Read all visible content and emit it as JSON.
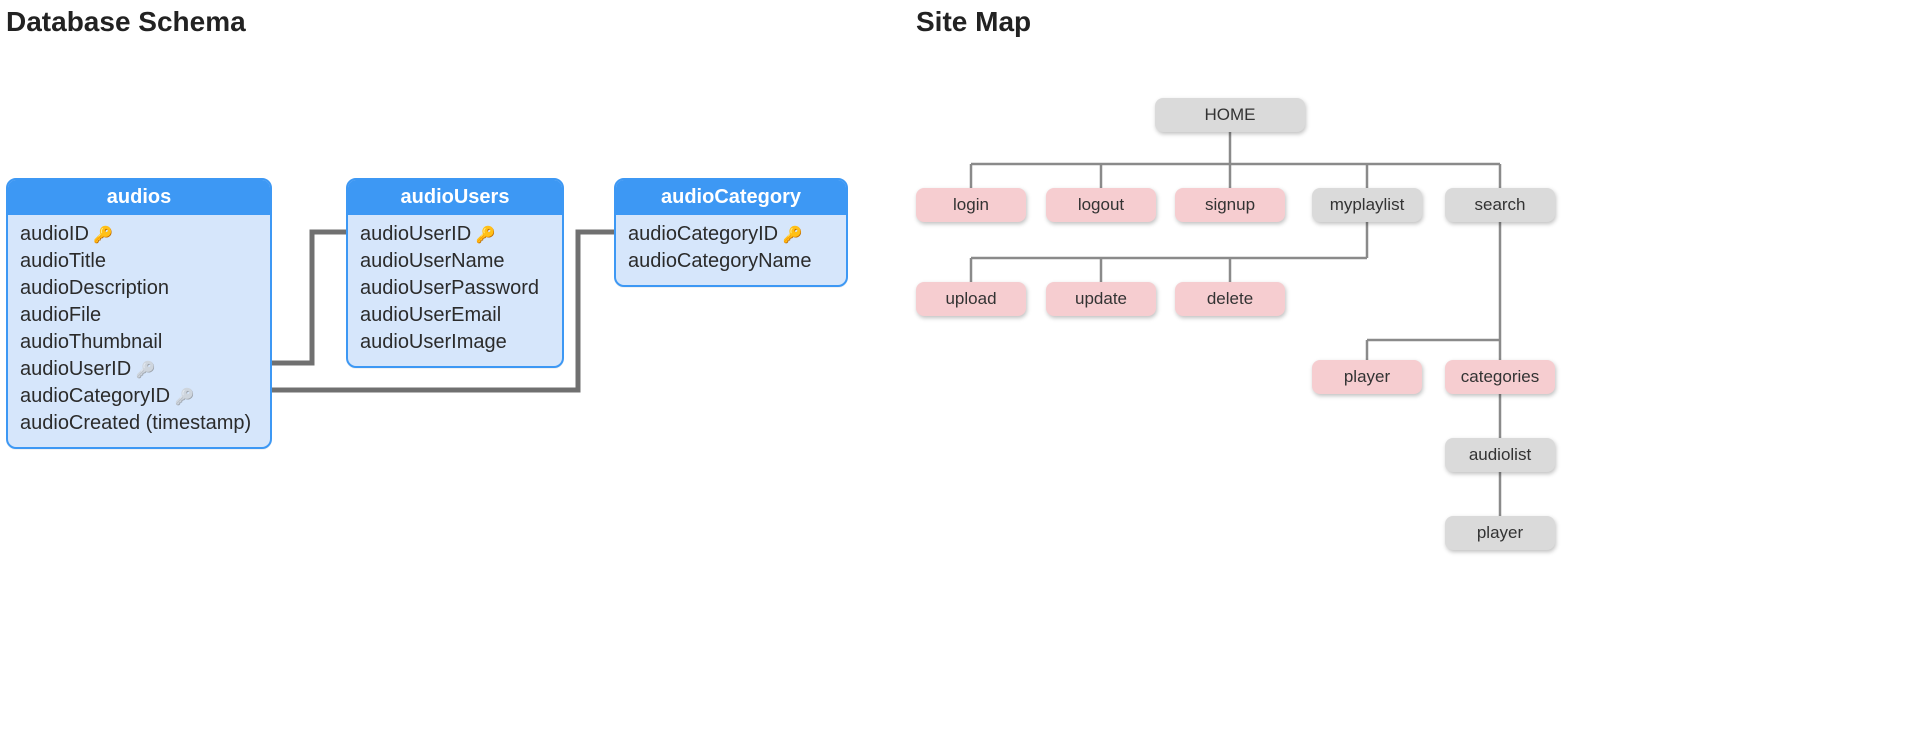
{
  "headings": {
    "schema": "Database Schema",
    "sitemap": "Site Map"
  },
  "schema": {
    "tables": [
      {
        "name": "audios",
        "fields": [
          {
            "name": "audioID",
            "key": "pk"
          },
          {
            "name": "audioTitle",
            "key": null
          },
          {
            "name": "audioDescription",
            "key": null
          },
          {
            "name": "audioFile",
            "key": null
          },
          {
            "name": "audioThumbnail",
            "key": null
          },
          {
            "name": "audioUserID",
            "key": "fk"
          },
          {
            "name": "audioCategoryID",
            "key": "fk"
          },
          {
            "name": "audioCreated (timestamp)",
            "key": null
          }
        ]
      },
      {
        "name": "audioUsers",
        "fields": [
          {
            "name": "audioUserID",
            "key": "pk"
          },
          {
            "name": "audioUserName",
            "key": null
          },
          {
            "name": "audioUserPassword",
            "key": null
          },
          {
            "name": "audioUserEmail",
            "key": null
          },
          {
            "name": "audioUserImage",
            "key": null
          }
        ]
      },
      {
        "name": "audioCategory",
        "fields": [
          {
            "name": "audioCategoryID",
            "key": "pk"
          },
          {
            "name": "audioCategoryName",
            "key": null
          }
        ]
      }
    ],
    "relations": [
      {
        "from": "audios.audioUserID",
        "to": "audioUsers.audioUserID"
      },
      {
        "from": "audios.audioCategoryID",
        "to": "audioCategory.audioCategoryID"
      }
    ]
  },
  "sitemap": {
    "root": {
      "label": "HOME",
      "color": "gray"
    },
    "level1": [
      {
        "label": "login",
        "color": "pink"
      },
      {
        "label": "logout",
        "color": "pink"
      },
      {
        "label": "signup",
        "color": "pink"
      },
      {
        "label": "myplaylist",
        "color": "gray"
      },
      {
        "label": "search",
        "color": "gray"
      }
    ],
    "myplaylist_children": [
      {
        "label": "upload",
        "color": "pink"
      },
      {
        "label": "update",
        "color": "pink"
      },
      {
        "label": "delete",
        "color": "pink"
      }
    ],
    "search_children": [
      {
        "label": "player",
        "color": "pink"
      },
      {
        "label": "categories",
        "color": "pink"
      }
    ],
    "categories_children": [
      {
        "label": "audiolist",
        "color": "gray"
      }
    ],
    "audiolist_children": [
      {
        "label": "player",
        "color": "gray"
      }
    ]
  }
}
